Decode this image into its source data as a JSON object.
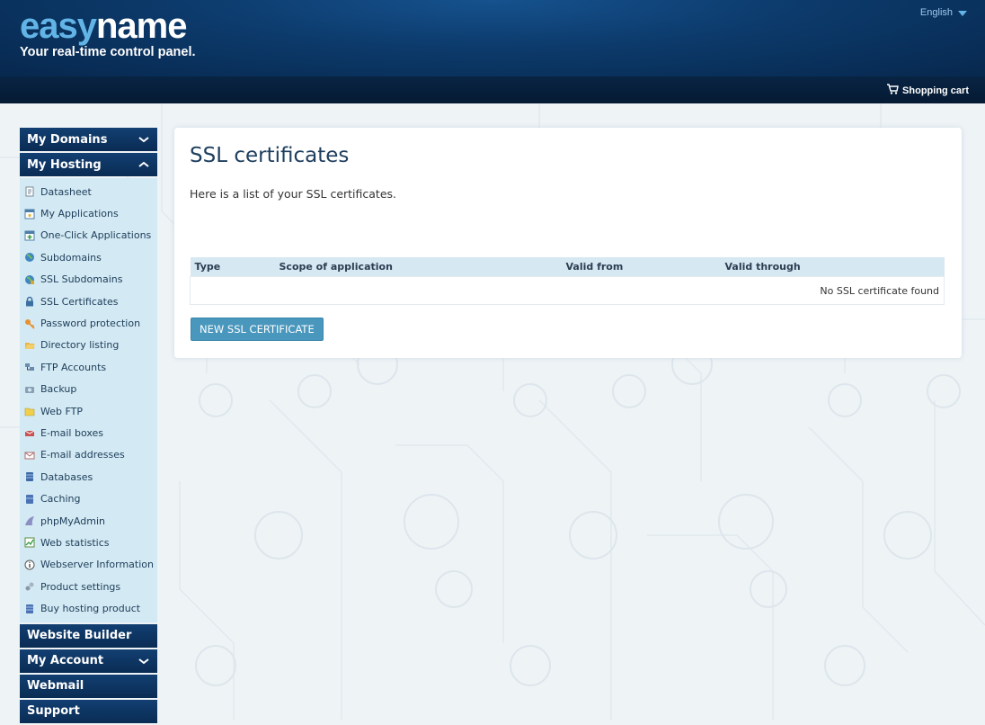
{
  "header": {
    "logo_part1": "easy",
    "logo_part2": "name",
    "tagline": "Your real-time control panel.",
    "language": "English",
    "cart_label": "Shopping cart"
  },
  "sidebar": {
    "sections": [
      {
        "label": "My Domains",
        "chevron": "down"
      },
      {
        "label": "My Hosting",
        "chevron": "up"
      },
      {
        "label": "Website Builder",
        "chevron": ""
      },
      {
        "label": "My Account",
        "chevron": "down"
      },
      {
        "label": "Webmail",
        "chevron": ""
      },
      {
        "label": "Support",
        "chevron": ""
      }
    ],
    "hosting_items": [
      {
        "label": "Datasheet",
        "icon": "document-icon"
      },
      {
        "label": "My Applications",
        "icon": "window-icon"
      },
      {
        "label": "One-Click Applications",
        "icon": "add-window-icon"
      },
      {
        "label": "Subdomains",
        "icon": "globe-icon"
      },
      {
        "label": "SSL Subdomains",
        "icon": "secure-globe-icon"
      },
      {
        "label": "SSL Certificates",
        "icon": "lock-icon"
      },
      {
        "label": "Password protection",
        "icon": "key-icon"
      },
      {
        "label": "Directory listing",
        "icon": "folder-open-icon"
      },
      {
        "label": "FTP Accounts",
        "icon": "ftp-icon"
      },
      {
        "label": "Backup",
        "icon": "backup-icon"
      },
      {
        "label": "Web FTP",
        "icon": "folder-icon"
      },
      {
        "label": "E-mail boxes",
        "icon": "mailbox-icon"
      },
      {
        "label": "E-mail addresses",
        "icon": "envelope-icon"
      },
      {
        "label": "Databases",
        "icon": "database-icon"
      },
      {
        "label": "Caching",
        "icon": "cache-icon"
      },
      {
        "label": "phpMyAdmin",
        "icon": "phpmyadmin-icon"
      },
      {
        "label": "Web statistics",
        "icon": "chart-icon"
      },
      {
        "label": "Webserver Information",
        "icon": "info-icon"
      },
      {
        "label": "Product settings",
        "icon": "settings-icon"
      },
      {
        "label": "Buy hosting product",
        "icon": "buy-icon"
      }
    ]
  },
  "main": {
    "title": "SSL certificates",
    "intro": "Here is a list of your SSL certificates.",
    "table": {
      "columns": [
        "Type",
        "Scope of application",
        "Valid from",
        "Valid through"
      ],
      "empty_message": "No SSL certificate found"
    },
    "new_button": "NEW SSL CERTIFICATE"
  },
  "colors": {
    "header_blue": "#0c3a6b",
    "logo_light_blue": "#62b4e6",
    "nav_dark_blue": "#0a2c54",
    "submenu_bg": "#d3e9f3",
    "button_blue": "#4a97bd"
  }
}
